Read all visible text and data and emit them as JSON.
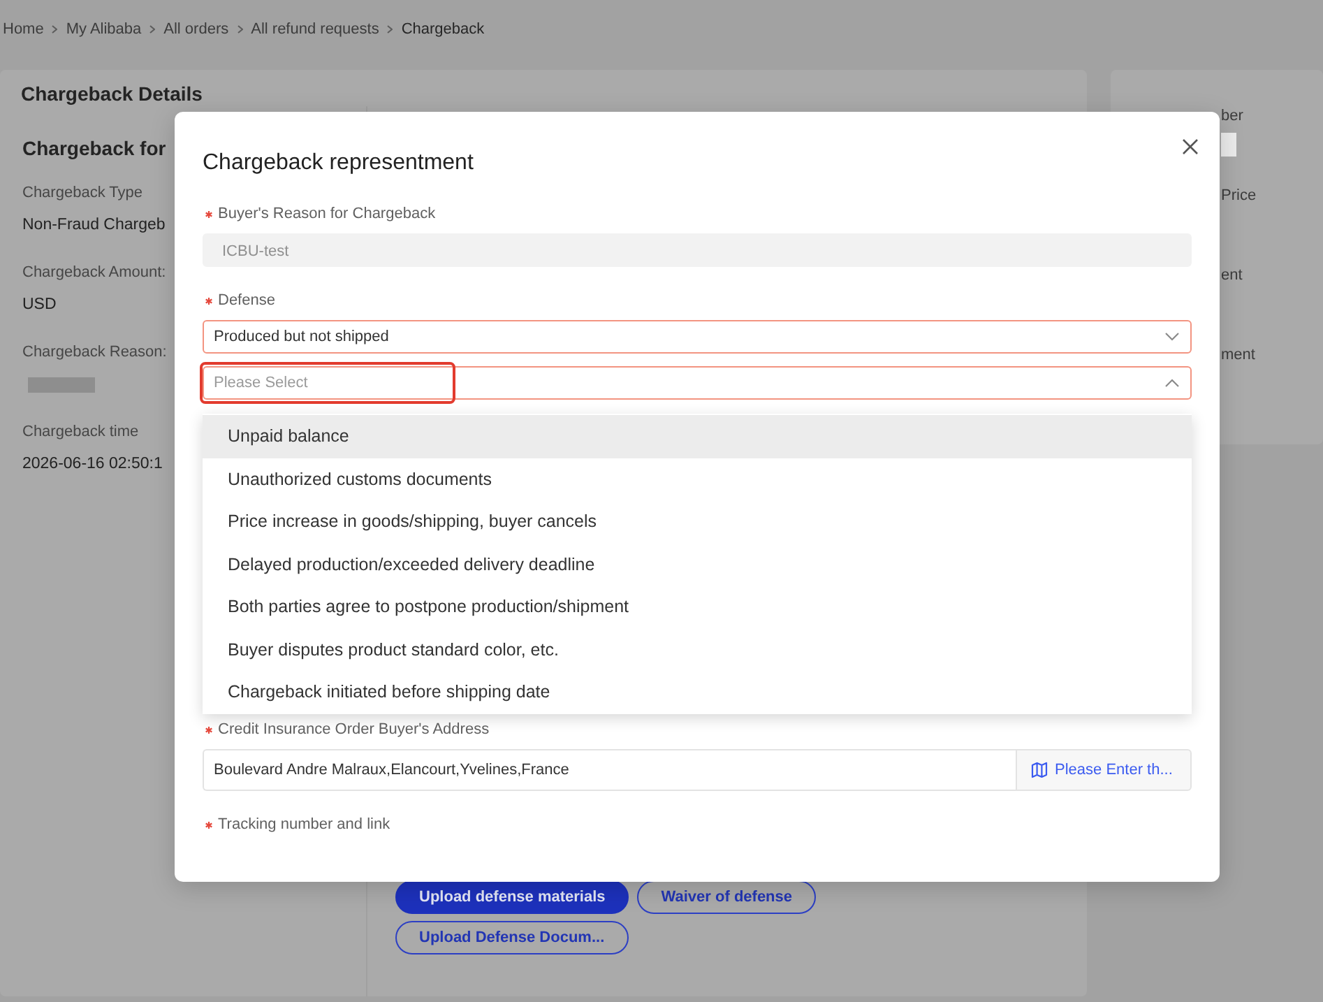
{
  "breadcrumb": [
    "Home",
    "My Alibaba",
    "All orders",
    "All refund requests",
    "Chargeback"
  ],
  "details_card": {
    "title": "Chargeback Details",
    "section_title": "Chargeback for",
    "fields": [
      {
        "label": "Chargeback Type",
        "kind": "text",
        "value": "Non-Fraud Chargeb"
      },
      {
        "label": "Chargeback Amount:",
        "kind": "text",
        "value": "USD"
      },
      {
        "label": "Chargeback Reason:",
        "kind": "redacted"
      },
      {
        "label": "Chargeback time",
        "kind": "text",
        "value": "2026-06-16 02:50:1"
      }
    ],
    "buttons": [
      {
        "label": "Upload defense materials",
        "primary": true
      },
      {
        "label": "Waiver of defense",
        "primary": false
      },
      {
        "label": "Upload Defense Docum...",
        "primary": false
      }
    ]
  },
  "summary_card": {
    "items": [
      {
        "label": "ber",
        "redacted_value": true
      },
      {
        "label": "Price",
        "redacted_value": false
      },
      {
        "label": "ent",
        "redacted_value": false
      },
      {
        "label": "ment",
        "redacted_value": false
      }
    ]
  },
  "modal": {
    "title": "Chargeback representment",
    "fields": [
      {
        "kind": "input",
        "label": "Buyer's Reason for Chargeback",
        "required": true,
        "value": "ICBU-test",
        "disabled": true
      },
      {
        "kind": "select",
        "label": "Defense",
        "required": true,
        "value": "Produced but not shipped",
        "error": true,
        "expanded": false,
        "highlighted": false
      },
      {
        "kind": "select",
        "placeholder": "Please Select",
        "error": true,
        "expanded": true,
        "highlighted": true,
        "options": [
          {
            "label": "Unpaid balance",
            "selected": true
          },
          {
            "label": "Unauthorized customs documents",
            "selected": false
          },
          {
            "label": "Price increase in goods/shipping, buyer cancels",
            "selected": false
          },
          {
            "label": "Delayed production/exceeded delivery deadline",
            "selected": false
          },
          {
            "label": "Both parties agree to postpone production/shipment",
            "selected": false
          },
          {
            "label": "Buyer disputes product standard color, etc.",
            "selected": false
          },
          {
            "label": "Chargeback initiated before shipping date",
            "selected": false
          }
        ]
      },
      {
        "kind": "address",
        "label": "Credit Insurance Order Buyer's Address",
        "required": true,
        "value": "Boulevard Andre Malraux,Elancourt,Yvelines,France",
        "action": "Please Enter th..."
      },
      {
        "kind": "label",
        "label": "Tracking number and link",
        "required": true
      }
    ]
  }
}
